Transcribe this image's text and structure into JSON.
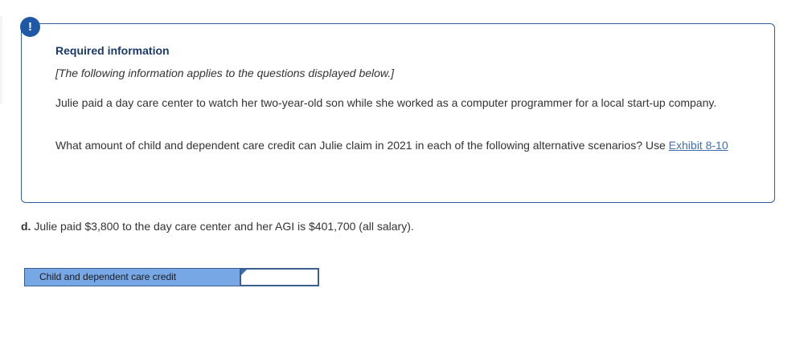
{
  "alert": {
    "icon": "exclamation-icon",
    "glyph": "!",
    "color": "#1f58a6"
  },
  "info": {
    "title": "Required information",
    "note": "[The following information applies to the questions displayed below.]",
    "paragraph1": "Julie paid a day care center to watch her two-year-old son while she worked as a computer programmer for a local start-up company.",
    "paragraph2": "What amount of child and dependent care credit can Julie claim in 2021 in each of the following alternative scenarios? Use ",
    "exhibit_link": "Exhibit 8-10"
  },
  "question": {
    "letter": "d.",
    "text": " Julie paid $3,800 to the day care center and her AGI is $401,700 (all salary)."
  },
  "answer": {
    "label": "Child and dependent care credit",
    "value": ""
  },
  "colors": {
    "accent": "#1f58a6",
    "title": "#1c3a69",
    "link": "#3e6fb3",
    "label_bg": "#78a7e6"
  }
}
